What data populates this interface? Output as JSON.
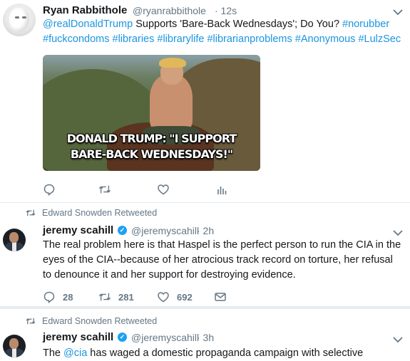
{
  "tweet1": {
    "name": "Ryan Rabbithole",
    "handle": "@ryanrabbithole",
    "time": "· 12s",
    "text_mention": "@realDonaldTrump",
    "text_body": " Supports 'Bare-Back Wednesdays'; Do You? ",
    "hashtags_line1": "#norubber",
    "hashtags_line2": "#fuckcondoms #libraries #librarylife #librarianproblems #Anonymous #LulzSec",
    "image_caption": "DONALD TRUMP: \"I SUPPORT\nBARE-BACK WEDNESDAYS!\""
  },
  "tweet2": {
    "retweeted_by": "Edward Snowden Retweeted",
    "name": "jeremy scahill",
    "handle": "@jeremyscahill",
    "time": "· 2h",
    "text": "The real problem here is that Haspel is the perfect person to run the CIA in the eyes of the CIA--because of her atrocious track record on torture, her refusal to denounce it and her support for destroying evidence.",
    "reply_count": "28",
    "retweet_count": "281",
    "like_count": "692"
  },
  "tweet3": {
    "retweeted_by": "Edward Snowden Retweeted",
    "name": "jeremy scahill",
    "handle": "@jeremyscahill",
    "time": "· 3h",
    "text_start": "The ",
    "text_mention": "@cia",
    "text_rest": " has waged a domestic propaganda campaign with selective"
  },
  "colors": {
    "link": "#1b95e0",
    "muted": "#657786",
    "verified": "#1da1f2",
    "divider": "#e6ecf0"
  },
  "icons": [
    "reply-icon",
    "retweet-icon",
    "like-icon",
    "analytics-icon",
    "direct-message-icon",
    "chevron-down-icon",
    "verified-badge-icon"
  ]
}
